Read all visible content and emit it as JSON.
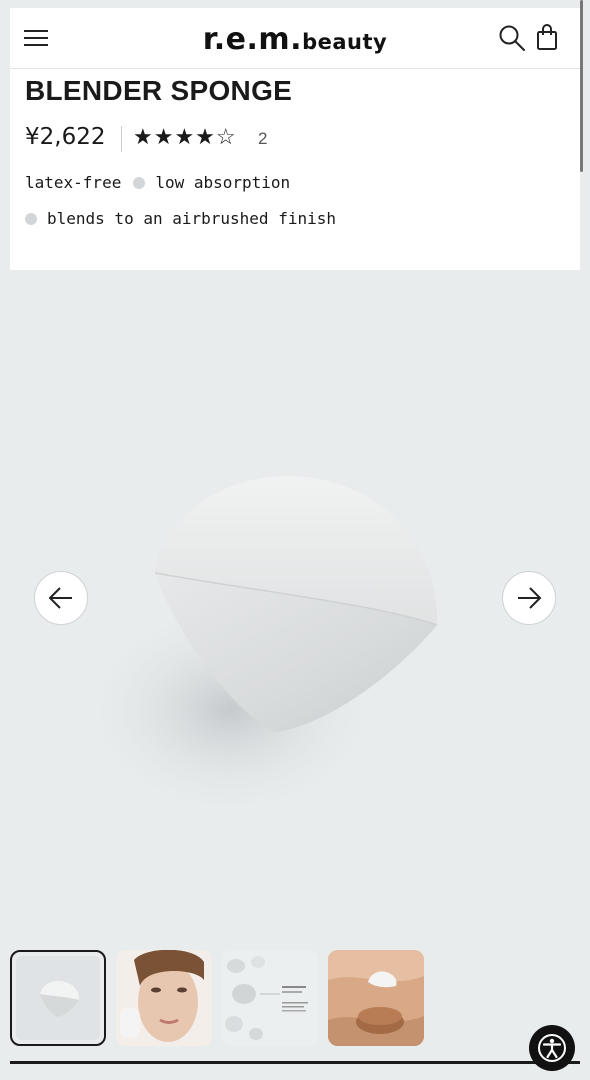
{
  "header": {
    "logo_main": "r.e.m.",
    "logo_sub": "beauty",
    "icons": [
      "menu-icon",
      "search-icon",
      "shopping-bag-icon"
    ]
  },
  "product": {
    "title": "BLENDER SPONGE",
    "price": "¥2,622",
    "rating": {
      "filled_stars": 4,
      "total_stars": 5,
      "stars_display": "★★★★☆"
    },
    "review_count": "2",
    "tags": [
      "latex-free",
      "low absorption",
      "blends to an airbrushed finish"
    ]
  },
  "gallery": {
    "icons": [
      "arrow-left-icon",
      "arrow-right-icon"
    ],
    "thumbnails": [
      "sponge",
      "model-face",
      "sponge-infographic",
      "sponge-with-foundation"
    ],
    "active_index": 0
  },
  "accessibility": {
    "icon": "accessibility-icon"
  },
  "colors": {
    "page_bg": "#e8eced",
    "panel_bg": "#ffffff",
    "text": "#1a1a1a",
    "dot": "#d3d6d8"
  }
}
